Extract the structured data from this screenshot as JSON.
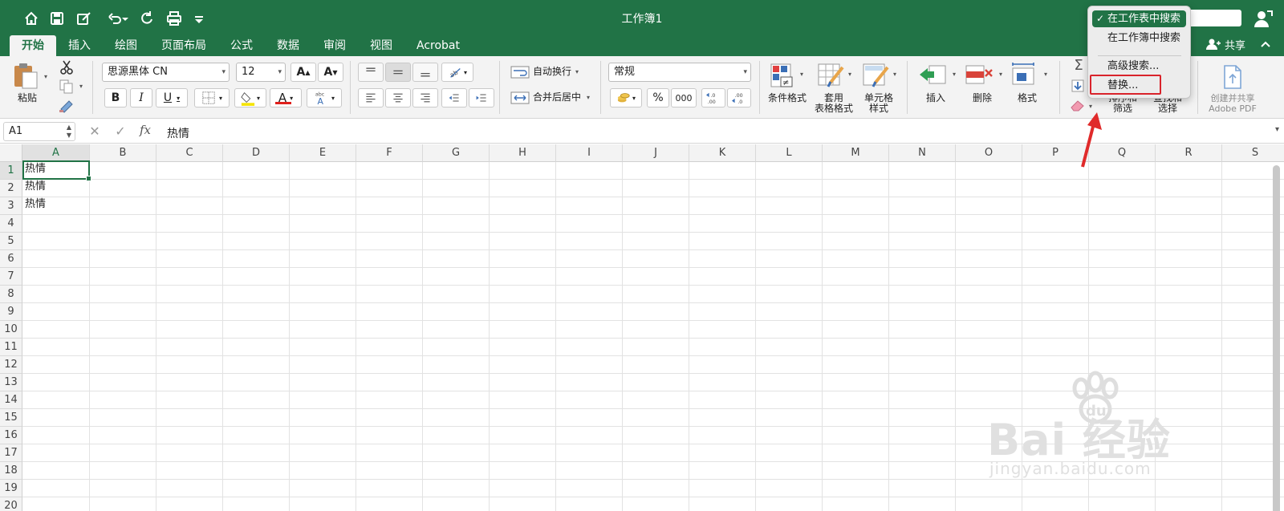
{
  "window": {
    "title": "工作簿1"
  },
  "tabs": [
    {
      "label": "开始",
      "active": true
    },
    {
      "label": "插入"
    },
    {
      "label": "绘图"
    },
    {
      "label": "页面布局"
    },
    {
      "label": "公式"
    },
    {
      "label": "数据"
    },
    {
      "label": "审阅"
    },
    {
      "label": "视图"
    },
    {
      "label": "Acrobat"
    }
  ],
  "share": {
    "label": "共享"
  },
  "ribbon": {
    "paste_label": "粘贴",
    "font_name": "思源黑体 CN",
    "font_size": "12",
    "bold": "B",
    "italic": "I",
    "underline": "U",
    "font_color_glyph": "A",
    "wrap_text": "自动换行",
    "merge_center": "合并后居中",
    "number_format": "常规",
    "percent": "%",
    "thousands": "000",
    "cond_format": "条件格式",
    "table_format": [
      "套用",
      "表格格式"
    ],
    "cell_style": [
      "单元格",
      "样式"
    ],
    "insert": "插入",
    "delete": "删除",
    "format": "格式",
    "sort_filter": [
      "排序和",
      "筛选"
    ],
    "find_select": [
      "查找和",
      "选择"
    ],
    "adobe": [
      "创建并共享",
      "Adobe PDF"
    ]
  },
  "formula_bar": {
    "name_box": "A1",
    "fx": "fx",
    "value": "热情"
  },
  "grid": {
    "columns": [
      "A",
      "B",
      "C",
      "D",
      "E",
      "F",
      "G",
      "H",
      "I",
      "J",
      "K",
      "L",
      "M",
      "N",
      "O",
      "P",
      "Q",
      "R",
      "S"
    ],
    "rows": [
      "1",
      "2",
      "3",
      "4",
      "5",
      "6",
      "7",
      "8",
      "9",
      "10",
      "11",
      "12",
      "13",
      "14",
      "15",
      "16",
      "17",
      "18",
      "19",
      "20"
    ],
    "cells": {
      "A1": "热情",
      "A2": "热情",
      "A3": "热情"
    }
  },
  "dropdown": {
    "items": [
      {
        "label": "在工作表中搜索",
        "checked": true
      },
      {
        "label": "在工作簿中搜索"
      },
      {
        "label": "高级搜索..."
      },
      {
        "label": "替换..."
      }
    ]
  },
  "watermark": {
    "main": "Bai 经验",
    "du": "du",
    "sub": "jingyan.baidu.com"
  },
  "colors": {
    "accent": "#217346",
    "highlight": "#d9232b"
  }
}
